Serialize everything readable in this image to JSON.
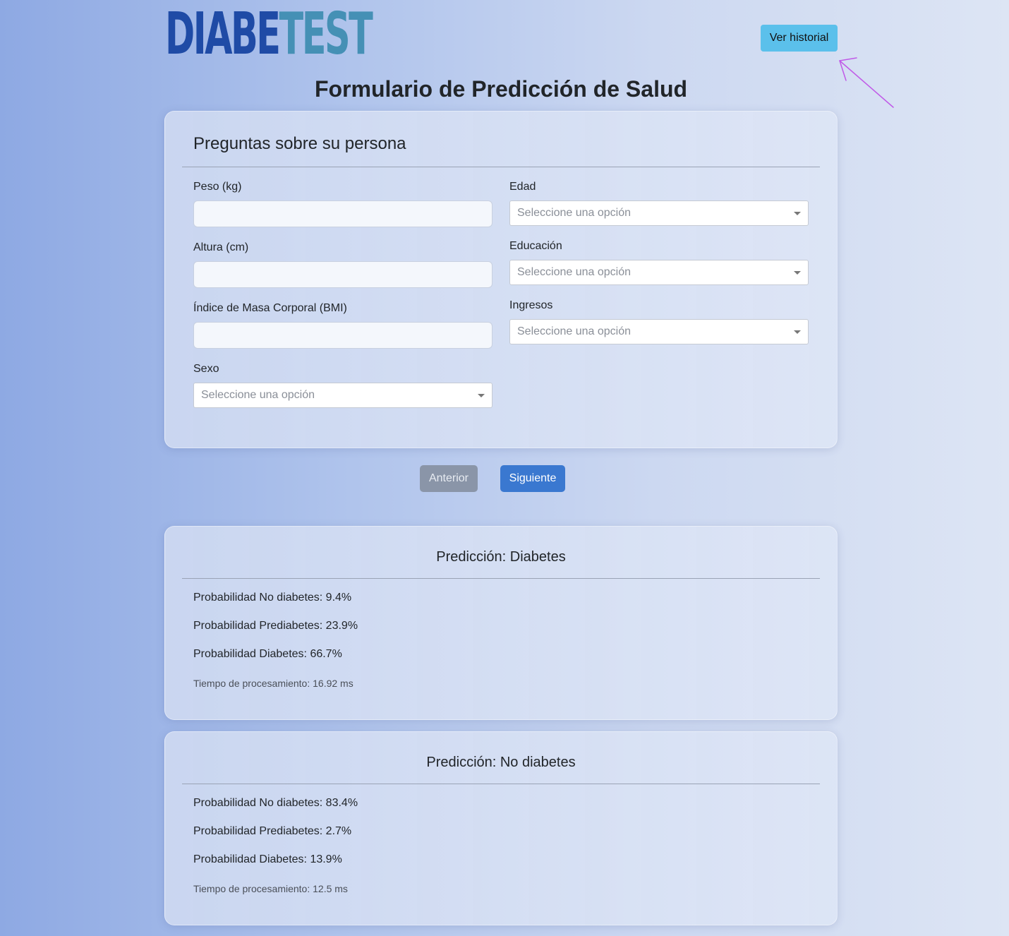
{
  "header": {
    "logo_part1": "DIABE",
    "logo_part2": "TEST",
    "history_button": "Ver historial"
  },
  "page_title": "Formulario de Predicción de Salud",
  "form": {
    "section_title": "Preguntas sobre su persona",
    "fields": {
      "peso": {
        "label": "Peso (kg)",
        "value": ""
      },
      "altura": {
        "label": "Altura (cm)",
        "value": ""
      },
      "bmi": {
        "label": "Índice de Masa Corporal (BMI)",
        "value": ""
      },
      "sexo": {
        "label": "Sexo",
        "selected": "Seleccione una opción"
      },
      "edad": {
        "label": "Edad",
        "selected": "Seleccione una opción"
      },
      "educacion": {
        "label": "Educación",
        "selected": "Seleccione una opción"
      },
      "ingresos": {
        "label": "Ingresos",
        "selected": "Seleccione una opción"
      }
    }
  },
  "navigation": {
    "prev_label": "Anterior",
    "next_label": "Siguiente"
  },
  "results": [
    {
      "title": "Predicción: Diabetes",
      "lines": [
        "Probabilidad No diabetes: 9.4%",
        "Probabilidad Prediabetes: 23.9%",
        "Probabilidad Diabetes: 66.7%"
      ],
      "time": "Tiempo de procesamiento: 16.92 ms"
    },
    {
      "title": "Predicción: No diabetes",
      "lines": [
        "Probabilidad No diabetes: 83.4%",
        "Probabilidad Prediabetes: 2.7%",
        "Probabilidad Diabetes: 13.9%"
      ],
      "time": "Tiempo de procesamiento: 12.5 ms"
    }
  ],
  "colors": {
    "logo_dark": "#1f4ba6",
    "logo_light": "#4590b5",
    "history_button": "#5bc0eb",
    "next_button": "#3a78d0",
    "prev_button": "#8a95a8",
    "annotation_arrow": "#c05ae8"
  }
}
